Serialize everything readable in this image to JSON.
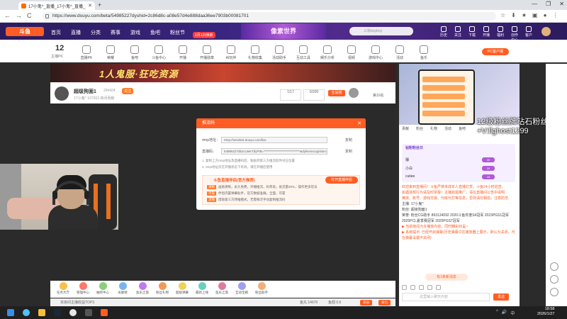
{
  "browser": {
    "tab_title": "17小鬼^_直播_17小鬼^_直播_17小鬼^",
    "url": "https://www.douyu.com/beta/54985227dyshid=2c86d8c-a08e57d4e888daa36ee7903b00081701",
    "controls": [
      "←",
      "→",
      "C"
    ],
    "icons_right": [
      "☆",
      "⬇",
      "★",
      "▣",
      "●",
      "⋮"
    ],
    "window_buttons": [
      "—",
      "❐",
      "✕"
    ]
  },
  "site": {
    "logo": "斗鱼",
    "nav": [
      "首页",
      "直播",
      "分类",
      "赛事",
      "游戏",
      "鱼吧",
      "粉丝节"
    ],
    "promo": "1月1日焕新",
    "banner": "像素世界",
    "search_placeholder": "三秋boyboy",
    "header_icons": [
      "历史",
      "关注",
      "下载",
      "开播",
      "福利",
      "创作中心",
      "客户"
    ]
  },
  "category_bar": {
    "count": "12",
    "count_label": "主播PK",
    "items": [
      "直播PK",
      "荣耀",
      "鱼吧",
      "斗鱼中心",
      "开播",
      "开播勋章",
      "AI玩伴",
      "礼物收集",
      "活动助手",
      "互动工具",
      "娱乐分析",
      "视频",
      "游戏中心",
      "活动",
      "鱼乐"
    ],
    "pc_button": "PC客户端"
  },
  "room": {
    "ad_text": "1人鬼服·狂吃资源",
    "title": "超级狗面1",
    "id": "294424",
    "badge": "关注",
    "sub": "17小鬼^  107263  房间贡献",
    "stats": [
      {
        "label": "1/17"
      },
      {
        "label": "0/200"
      }
    ],
    "all_rank": "全站榜",
    "rank_text": "第10名"
  },
  "modal": {
    "title": "推流码",
    "close": "✕",
    "rtmp_label": "rtmp地址：",
    "rtmp_value": "rtmp://sendtc5.douyu.com/live",
    "code_label": "直播码：",
    "code_value": "5498522?d5JcUwKTdyPIB=*****************************&dyliverecognition=0",
    "copy": "复制",
    "note1": "1. 复制上方rtmp地址及直播码后，粘贴到第三方推流软件对应位置",
    "note2": "2. rtmp地址仅在开播状态下有效，请在开播后使用",
    "box_title": "斗鱼直播伴侣(官方推荐)",
    "box_btn": "打开直播伴侣",
    "tags": [
      {
        "tag": "清晰",
        "text": "画质清晰，永久免费，开播推流，码率高，省流量20%，操作更多玩法"
      },
      {
        "tag": "可靠",
        "text": "伴侣内置弹幕助手，官方数据准确，全面，可靠"
      },
      {
        "tag": "流畅",
        "text": "借助第三方转推模式，无需每次手动复制推流码"
      }
    ]
  },
  "gifts": [
    "任务大厅",
    "管理中心",
    "抽奖中心",
    "贡献榜",
    "鱼乐之旅",
    "粉丝礼物",
    "超级弹幕",
    "最新上线",
    "鱼乐之旅",
    "互动宝箱",
    "粉丝助手"
  ],
  "bottom_strip": {
    "left": "本房间主播收益TOP3",
    "right1": "鱼丸 14670",
    "right2": "鱼翅 0.6",
    "btn1": "充值",
    "btn2": "背包"
  },
  "right_panel": {
    "tabs": [
      "贡献",
      "粉丝",
      "礼物",
      "活动",
      "鱼吧"
    ],
    "watermark_line1": "12级粉丝牌钻石粉丝",
    "watermark_line2": "+V:llghost1299",
    "rank_header": "钻粉粉丝日",
    "rank_rows": [
      {
        "name": "摆",
        "pill": "20"
      },
      {
        "name": "小白",
        "pill": "19"
      },
      {
        "name": "cutiee",
        "pill": "18"
      }
    ],
    "chat_lines": [
      "欢迎来到直播间！斗鱼严禁未成年人直播打赏，斗鱼24小时巡查，",
      "如遇违规行为请及时举报！主播如需推广，请在直播间公告中说明",
      "推流、账号、游戏交易、代练代打等信息，否则请勿相信，注意防范",
      "主播: 17小鬼^",
      "粉丝: 超级狗面1",
      "荣誉: 粉丝CG助手 863134092 2020斗鱼年度S4冠军 2023PGS1冠军 2025PCL夏季赛冠军 2025PGS7冠军",
      "▶ 当前房间允许播放内容，同时精彩纷呈~",
      "▶ 系统提示: 已经开启弹幕(历史弹幕只在播放器上展示，默认为关闭，可在弹幕设置中关闭)"
    ],
    "more_chat": "有1条新消息",
    "input_placeholder": "这里输入聊天内容",
    "send": "发送"
  },
  "taskbar": {
    "time": "18:58",
    "date": "2026/1/27",
    "tray": [
      "^",
      "🔊",
      "中"
    ]
  }
}
